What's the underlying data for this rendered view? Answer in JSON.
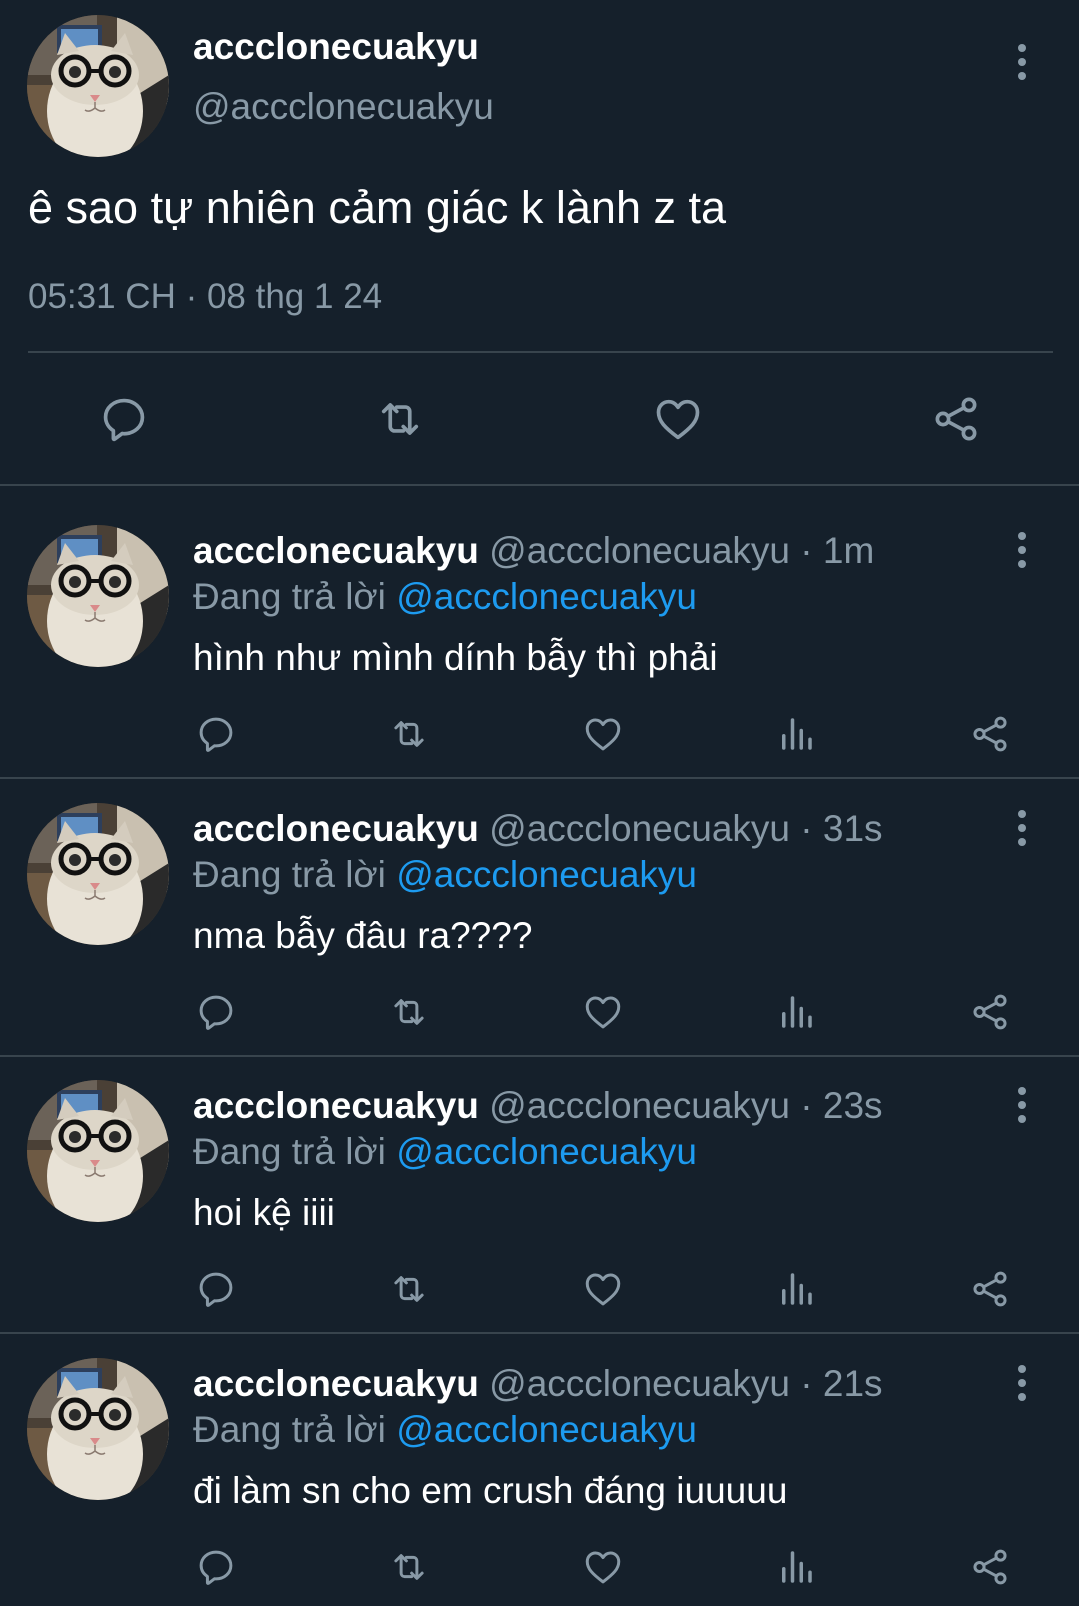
{
  "main_tweet": {
    "display_name": "accclonecuakyu",
    "handle": "@accclonecuakyu",
    "text": "ê sao tự nhiên cảm giác k lành z ta",
    "timestamp": "05:31 CH · 08 thg 1 24",
    "actions": [
      "reply-icon",
      "retweet-icon",
      "like-icon",
      "share-icon"
    ]
  },
  "replies": [
    {
      "display_name": "accclonecuakyu",
      "handle_time": " @accclonecuakyu · 1m",
      "replying_prefix": "Đang trả lời ",
      "mention": "@accclonecuakyu",
      "text": "hình như mình dính bẫy thì phải"
    },
    {
      "display_name": "accclonecuakyu",
      "handle_time": " @accclonecuakyu · 31s",
      "replying_prefix": "Đang trả lời ",
      "mention": "@accclonecuakyu",
      "text": "nma bẫy đâu ra????"
    },
    {
      "display_name": "accclonecuakyu",
      "handle_time": " @accclonecuakyu · 23s",
      "replying_prefix": "Đang trả lời ",
      "mention": "@accclonecuakyu",
      "text": "hoi kệ iiii"
    },
    {
      "display_name": "accclonecuakyu",
      "handle_time": " @accclonecuakyu · 21s",
      "replying_prefix": "Đang trả lời ",
      "mention": "@accclonecuakyu",
      "text": "đi làm sn cho em crush đáng iuuuuu"
    }
  ],
  "reply_actions": [
    "reply-icon",
    "retweet-icon",
    "like-icon",
    "views-icon",
    "share-icon"
  ],
  "colors": {
    "background": "#15202b",
    "primary_text": "#ffffff",
    "secondary_text": "#8899a6",
    "link": "#1d9bf0",
    "divider": "#38444d"
  }
}
